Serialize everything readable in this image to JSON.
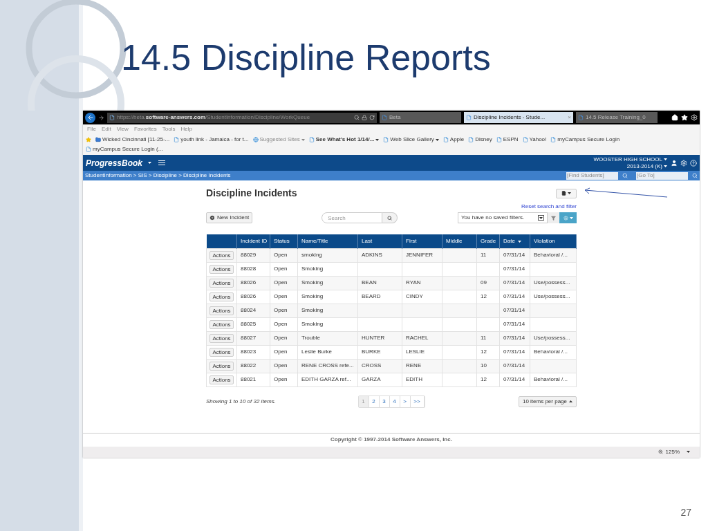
{
  "slide": {
    "title": "14.5 Discipline Reports",
    "page_number": "27"
  },
  "browser": {
    "address": "https://beta.**software-answers.com**/StudentInformation/Discipline/WorkQueue",
    "tabs": [
      {
        "label": "Beta",
        "selected": false
      },
      {
        "label": "Discipline Incidents - Stude...",
        "selected": true,
        "close": "×"
      },
      {
        "label": "14.5 Release Training_0",
        "selected": false
      }
    ],
    "menu": [
      "File",
      "Edit",
      "View",
      "Favorites",
      "Tools",
      "Help"
    ],
    "favorites": [
      {
        "label": "Wicked Cincinnati [11-25-...",
        "kind": "folder",
        "bold": false,
        "dropdown": false
      },
      {
        "label": "youth link - Jamaica - for t...",
        "kind": "page",
        "bold": false,
        "dropdown": false
      },
      {
        "label": "Suggested Sites",
        "kind": "globe",
        "bold": false,
        "dropdown": true
      },
      {
        "label": "See What's Hot 1/14/...",
        "kind": "page",
        "bold": true,
        "dropdown": true
      },
      {
        "label": "Web Slice Gallery",
        "kind": "page",
        "bold": false,
        "dropdown": true
      },
      {
        "label": "Apple",
        "kind": "page",
        "bold": false,
        "dropdown": false
      },
      {
        "label": "Disney",
        "kind": "page",
        "bold": false,
        "dropdown": false
      },
      {
        "label": "ESPN",
        "kind": "page",
        "bold": false,
        "dropdown": false
      },
      {
        "label": "Yahoo!",
        "kind": "page",
        "bold": false,
        "dropdown": false
      },
      {
        "label": "myCampus Secure Login",
        "kind": "page",
        "bold": false,
        "dropdown": false
      },
      {
        "label": "myCampus Secure Login (...",
        "kind": "page",
        "bold": false,
        "dropdown": false
      }
    ],
    "zoom": "125%"
  },
  "app": {
    "logo": "ProgressBook",
    "school": "WOOSTER HIGH SCHOOL",
    "year": "2013-2014 (K)",
    "breadcrumb": "StudentInformation > SIS > Discipline > Discipline Incidents",
    "find_students": {
      "placeholder": "[Find Students]"
    },
    "go_to": {
      "placeholder": "[Go To]"
    },
    "page_title": "Discipline Incidents",
    "reset_link": "Reset search and filter",
    "new_button": "New Incident",
    "search": {
      "placeholder": "Search"
    },
    "saved_filters": "You have no saved filters.",
    "columns": [
      {
        "label": "Incident ID",
        "sorted": false
      },
      {
        "label": "Status",
        "sorted": false
      },
      {
        "label": "Name/Title",
        "sorted": false
      },
      {
        "label": "Last",
        "sorted": false
      },
      {
        "label": "First",
        "sorted": false
      },
      {
        "label": "Middle",
        "sorted": false
      },
      {
        "label": "Grade",
        "sorted": false
      },
      {
        "label": "Date",
        "sorted": true
      },
      {
        "label": "Violation",
        "sorted": false
      }
    ],
    "rows": [
      {
        "action": "Actions",
        "cells": [
          "88029",
          "Open",
          "smoking",
          "ADKINS",
          "JENNIFER",
          null,
          "11",
          "07/31/14",
          "Behavioral /..."
        ]
      },
      {
        "action": "Actions",
        "cells": [
          "88028",
          "Open",
          "Smoking",
          null,
          null,
          null,
          null,
          "07/31/14",
          null
        ]
      },
      {
        "action": "Actions",
        "cells": [
          "88026",
          "Open",
          "Smoking",
          "BEAN",
          "RYAN",
          null,
          "09",
          "07/31/14",
          "Use/possess..."
        ]
      },
      {
        "action": "Actions",
        "cells": [
          "88026",
          "Open",
          "Smoking",
          "BEARD",
          "CINDY",
          null,
          "12",
          "07/31/14",
          "Use/possess..."
        ]
      },
      {
        "action": "Actions",
        "cells": [
          "88024",
          "Open",
          "Smoking",
          null,
          null,
          null,
          null,
          "07/31/14",
          null
        ]
      },
      {
        "action": "Actions",
        "cells": [
          "88025",
          "Open",
          "Smoking",
          null,
          null,
          null,
          null,
          "07/31/14",
          null
        ]
      },
      {
        "action": "Actions",
        "cells": [
          "88027",
          "Open",
          "Trouble",
          "HUNTER",
          "RACHEL",
          null,
          "11",
          "07/31/14",
          "Use/possess..."
        ]
      },
      {
        "action": "Actions",
        "cells": [
          "88023",
          "Open",
          "Leslie Burke",
          "BURKE",
          "LESLIE",
          null,
          "12",
          "07/31/14",
          "Behavioral /..."
        ]
      },
      {
        "action": "Actions",
        "cells": [
          "88022",
          "Open",
          "RENE CROSS refe...",
          "CROSS",
          "RENE",
          null,
          "10",
          "07/31/14",
          null
        ]
      },
      {
        "action": "Actions",
        "cells": [
          "88021",
          "Open",
          "EDITH GARZA ref...",
          "GARZA",
          "EDITH",
          null,
          "12",
          "07/31/14",
          "Behavioral /..."
        ]
      }
    ],
    "showing": "Showing 1 to 10 of 32 items.",
    "pages": [
      {
        "label": "1",
        "selected": true
      },
      {
        "label": "2",
        "selected": false
      },
      {
        "label": "3",
        "selected": false
      },
      {
        "label": "4",
        "selected": false
      },
      {
        "label": ">",
        "selected": false
      },
      {
        "label": ">>",
        "selected": false
      }
    ],
    "per_page": "10 items per page",
    "copyright": "Copyright © 1997-2014 Software Answers, Inc."
  }
}
